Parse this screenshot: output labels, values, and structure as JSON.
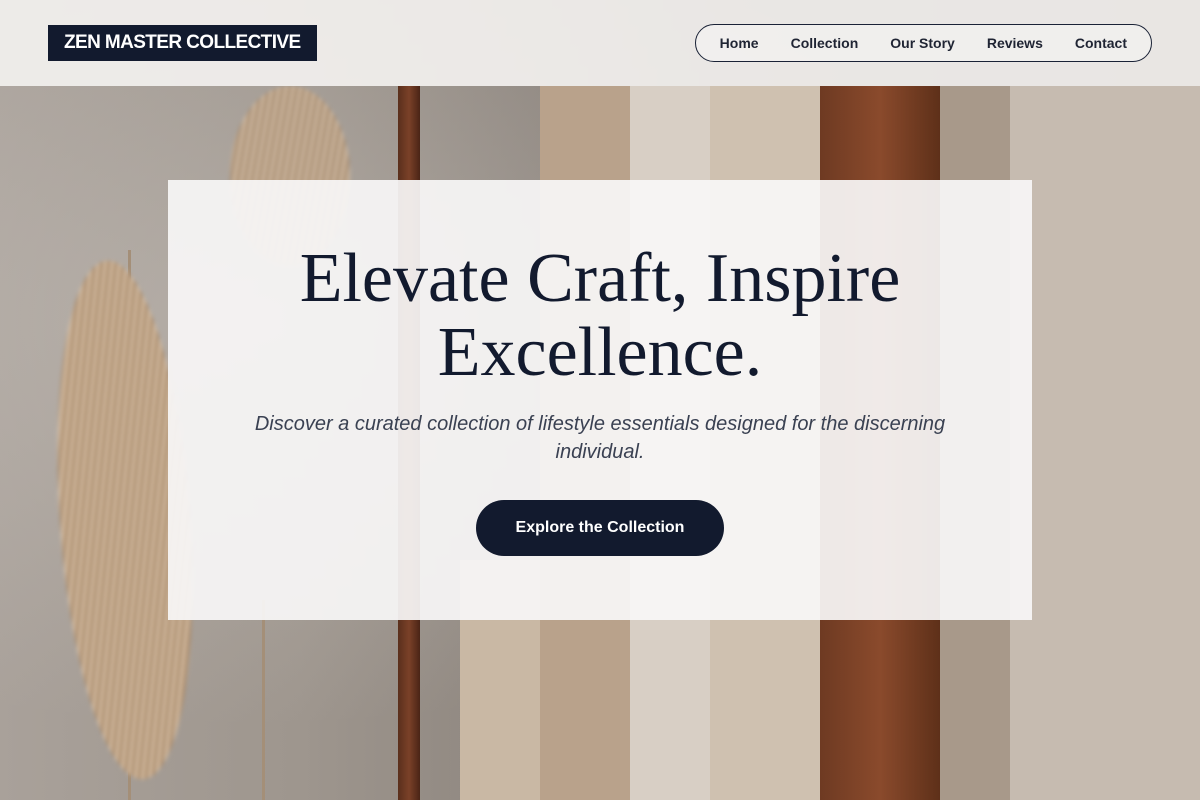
{
  "brand": {
    "logo_text": "ZEN MASTER COLLECTIVE"
  },
  "nav": {
    "items": [
      {
        "label": "Home"
      },
      {
        "label": "Collection"
      },
      {
        "label": "Our Story"
      },
      {
        "label": "Reviews"
      },
      {
        "label": "Contact"
      }
    ]
  },
  "hero": {
    "headline": "Elevate Craft, Inspire Excellence.",
    "subheadline": "Discover a curated collection of lifestyle essentials designed for the discerning individual.",
    "cta_label": "Explore the Collection"
  },
  "colors": {
    "primary_navy": "#121a2e",
    "card_background": "#f7f6f6",
    "header_background": "#f2f0ee"
  },
  "background": {
    "subject": "pampas-grass-and-knitwear-on-clothing-rack-photo"
  }
}
